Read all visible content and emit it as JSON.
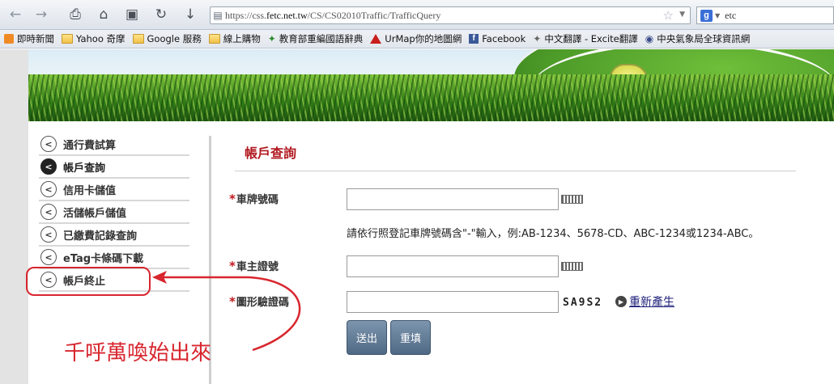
{
  "browser": {
    "url_prefix": "https://css.",
    "url_host": "fetc.net.tw",
    "url_path": "/CS/CS02010Traffic/TrafficQuery",
    "search_value": "etc",
    "search_engine": "g"
  },
  "bookmarks": [
    {
      "label": "即時新聞",
      "icon": "rss-icon"
    },
    {
      "label": "Yahoo 奇摩",
      "icon": "folder-icon"
    },
    {
      "label": "Google 服務",
      "icon": "folder-icon"
    },
    {
      "label": "線上購物",
      "icon": "folder-icon"
    },
    {
      "label": "教育部重編國語辭典",
      "icon": "moe-icon"
    },
    {
      "label": "UrMap你的地圖網",
      "icon": "urmap-icon"
    },
    {
      "label": "Facebook",
      "icon": "facebook-icon"
    },
    {
      "label": "中文翻譯 - Excite翻譯",
      "icon": "excite-icon"
    },
    {
      "label": "中央氣象局全球資訊網",
      "icon": "eye-icon"
    }
  ],
  "sidebar": {
    "items": [
      {
        "label": "通行費試算",
        "active": false
      },
      {
        "label": "帳戶查詢",
        "active": true
      },
      {
        "label": "信用卡儲值",
        "active": false
      },
      {
        "label": "活儲帳戶儲值",
        "active": false
      },
      {
        "label": "已繳費記錄查詢",
        "active": false
      },
      {
        "label": "eTag卡條碼下載",
        "active": false
      },
      {
        "label": "帳戶終止",
        "active": false
      }
    ]
  },
  "main": {
    "title": "帳戶查詢",
    "plate_label": "車牌號碼",
    "plate_value": "",
    "plate_hint": "請依行照登記車牌號碼含\"-\"輸入，例:AB-1234、5678-CD、ABC-1234或1234-ABC。",
    "owner_id_label": "車主證號",
    "owner_id_value": "",
    "captcha_label": "圖形驗證碼",
    "captcha_value": "",
    "captcha_image_text": "SA9S2",
    "regenerate_label": "重新產生",
    "required_mark": "*",
    "submit_label": "送出",
    "reset_label": "重填"
  },
  "annotation": {
    "text": "千呼萬喚始出來",
    "color": "#d8262e"
  },
  "colors": {
    "title_red": "#b0181e",
    "button_blue": "#5f7a96"
  }
}
